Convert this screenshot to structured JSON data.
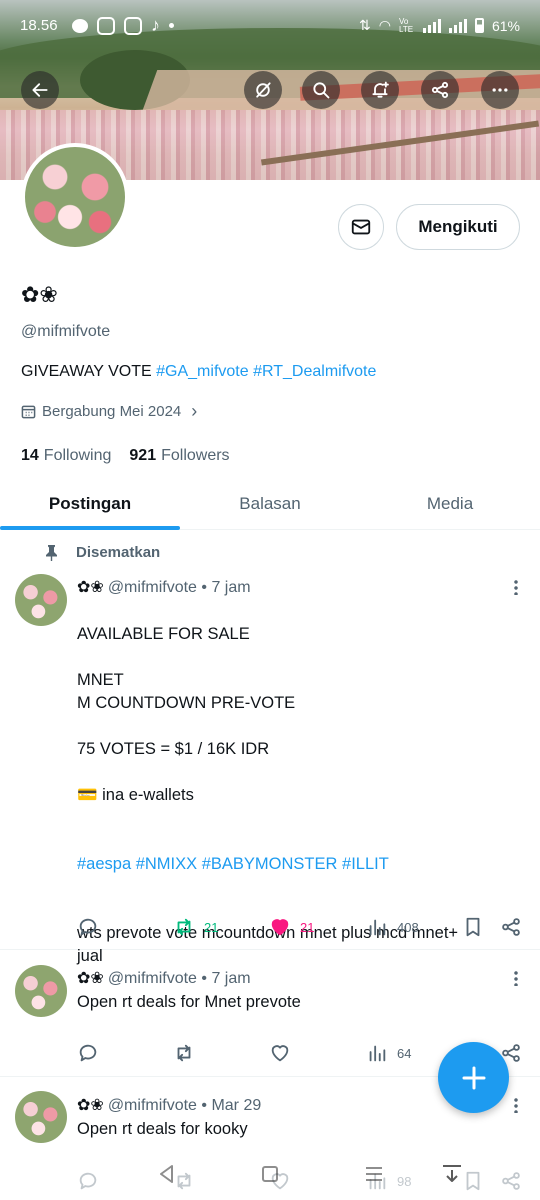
{
  "status_bar": {
    "time": "18.56",
    "network": "Vo LTE",
    "battery": "61%"
  },
  "colors": {
    "accent": "#1d9bf0",
    "retweet_active": "#00ba7c",
    "like_active": "#f91880",
    "secondary_text": "#536471"
  },
  "profile": {
    "name": "✿❀",
    "handle": "@mifmifvote",
    "bio_text": "GIVEAWAY VOTE ",
    "bio_tag1": "#GA_mifvote",
    "bio_tag2": "#RT_Dealmifvote",
    "joined": "Bergabung Mei 2024",
    "following_count": "14",
    "following_label": "Following",
    "followers_count": "921",
    "followers_label": "Followers",
    "follow_button": "Mengikuti"
  },
  "tabs": [
    "Postingan",
    "Balasan",
    "Media"
  ],
  "pinned_label": "Disematkan",
  "tweets": [
    {
      "name": "✿❀",
      "meta": "@mifmifvote • 7 jam",
      "body": "AVAILABLE FOR SALE\n\nMNET\nM COUNTDOWN PRE-VOTE\n\n75 VOTES = $1 / 16K IDR\n\n💳  ina e-wallets",
      "hashtags": "#aespa #NMIXX #BABYMONSTER #ILLIT",
      "footer": "wts  prevote vote mcountdown mnet plus mcd mnet+\njual",
      "retweets": "21",
      "likes": "21",
      "views": "408"
    },
    {
      "name": "✿❀",
      "meta": "@mifmifvote • 7 jam",
      "body": "Open rt deals for Mnet prevote",
      "views": "64"
    },
    {
      "name": "✿❀",
      "meta": "@mifmifvote • Mar 29",
      "body": "Open rt deals for kooky",
      "views": "98"
    }
  ]
}
